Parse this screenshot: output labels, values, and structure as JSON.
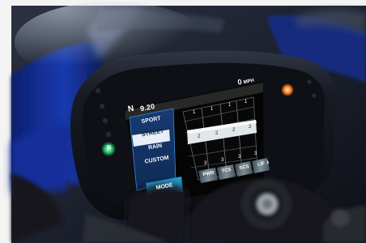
{
  "dashboard": {
    "fuel_or_gear_label": "N",
    "top_value": "9.20",
    "speed_unit": "MPH",
    "speed_value": "0",
    "neutral_indicator": "N",
    "modes": [
      "SPORT",
      "STREET",
      "RAIN",
      "CUSTOM"
    ],
    "selected_mode": "STREET",
    "mode_button": "MODE",
    "setting_tabs": [
      "PWR",
      "TCS",
      "SCS",
      "LIF"
    ],
    "setting_levels": [
      {
        "tab": "PWR",
        "top": "1",
        "mid": "2",
        "bottom": "3"
      },
      {
        "tab": "TCS",
        "top": "1",
        "mid": "2",
        "bottom": "3"
      },
      {
        "tab": "SCS",
        "top": "1",
        "mid": "2",
        "bottom": "3"
      },
      {
        "tab": "LIF",
        "top": "1",
        "mid": "2",
        "bottom": "3"
      }
    ],
    "next_arrow": "›",
    "colors": {
      "screen_bg": "#050505",
      "menu_bg": "#14366b",
      "selected": "#e8eef6",
      "mode_button": "#2aa3d8",
      "green_indicator": "#13a24b",
      "amber_indicator": "#ff7a1a"
    }
  }
}
